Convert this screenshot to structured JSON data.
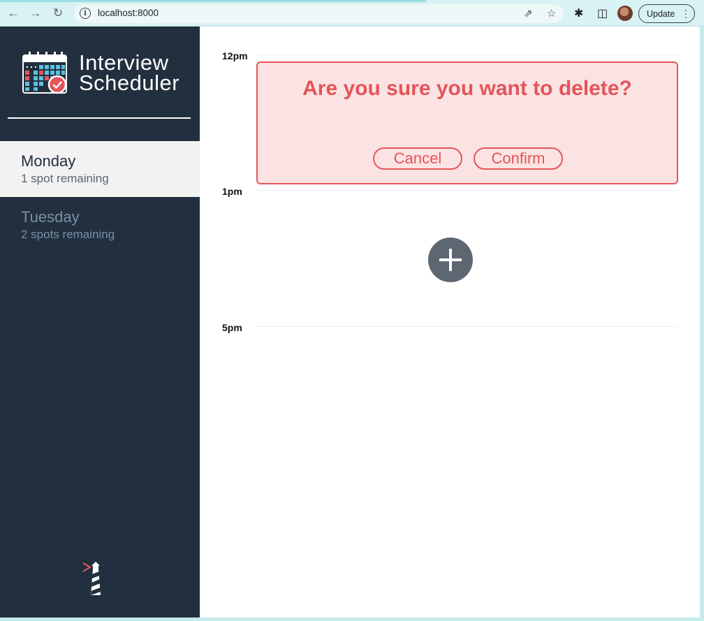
{
  "browser": {
    "url": "localhost:8000",
    "update_label": "Update"
  },
  "app": {
    "title_line1": "Interview",
    "title_line2": "Scheduler"
  },
  "days": [
    {
      "name": "Monday",
      "spots": "1 spot remaining",
      "selected": true
    },
    {
      "name": "Tuesday",
      "spots": "2 spots remaining",
      "selected": false
    }
  ],
  "schedule": {
    "times": [
      "12pm",
      "1pm",
      "5pm"
    ],
    "confirm": {
      "message": "Are you sure you want to delete?",
      "cancel_label": "Cancel",
      "confirm_label": "Confirm"
    },
    "add_icon": "plus-icon"
  },
  "colors": {
    "sidebar": "#222f3e",
    "danger": "#e5545a",
    "danger_bg": "#fbe3e3",
    "add_button": "#5d6772"
  }
}
